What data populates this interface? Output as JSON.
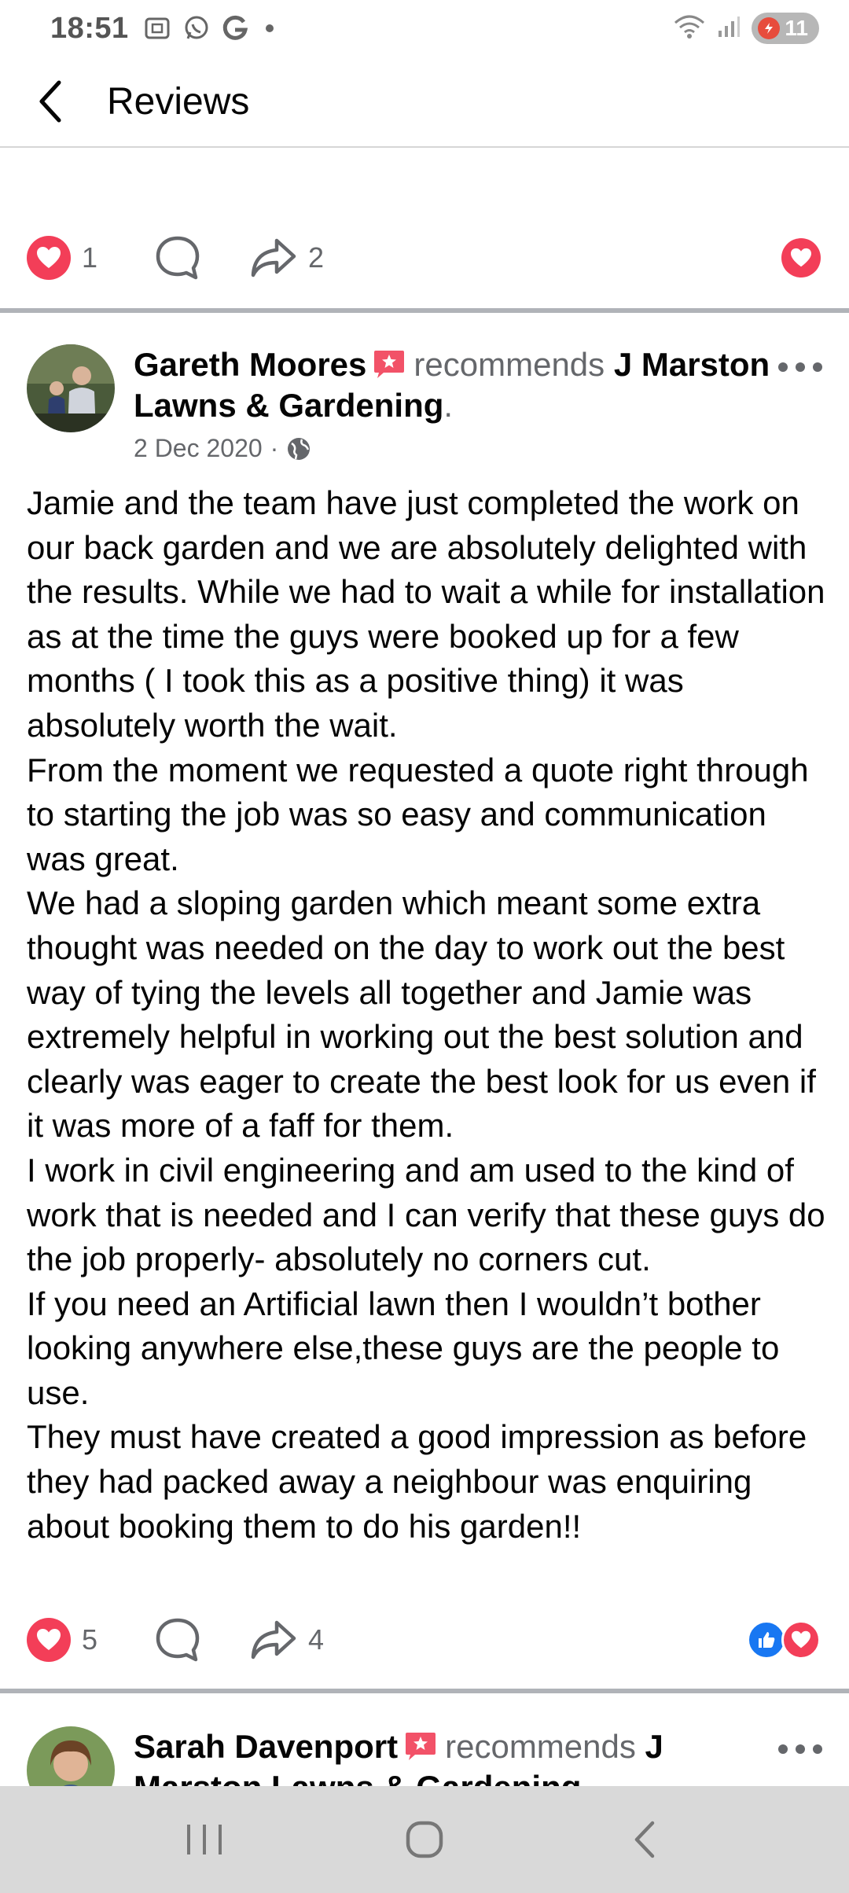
{
  "status_bar": {
    "time": "18:51",
    "battery_level": "11",
    "icons": [
      "screenshot-icon",
      "whatsapp-icon",
      "google-icon",
      "notification-dot",
      "wifi-icon",
      "signal-icon",
      "battery-icon"
    ]
  },
  "header": {
    "title": "Reviews",
    "back_icon": "chevron-left-icon"
  },
  "previous_post": {
    "reactions": {
      "love_count": "1",
      "share_count": "2"
    }
  },
  "post": {
    "author": "Gareth Moores",
    "recommends_text": "recommends",
    "page_name": "J Marston Lawns & Gardening",
    "date": "2 Dec 2020",
    "date_separator": "·",
    "privacy_icon": "globe-icon",
    "body": "Jamie and the team have just completed the work on our back garden and we are absolutely delighted with the results. While we had to wait a while for installation as at the time the guys were booked up for a few months ( I took this as a positive thing) it was absolutely worth the wait. \nFrom the moment we requested a quote right through to starting the job was so easy and communication was great. \nWe had a sloping garden which meant some extra thought was needed on the day to work out the best way of tying the levels all together and Jamie was extremely helpful in working out the best solution and clearly was eager to create the best look for us even if it was more of a faff for them. \nI work in civil engineering and am used to the kind of work that is needed and I can verify that these guys do the job properly- absolutely no corners cut. \nIf you need an Artificial lawn then I wouldn’t bother looking anywhere else,these guys are the people to use. \nThey must have created a good impression as before they had packed away a neighbour was enquiring about booking them to do his garden!!",
    "reactions": {
      "love_count": "5",
      "share_count": "4"
    }
  },
  "next_post": {
    "author": "Sarah Davenport",
    "recommends_text": "recommends",
    "page_name": "J Marston Lawns & Gardening"
  },
  "nav_bar": {
    "buttons": [
      "recent-apps-icon",
      "home-icon",
      "back-icon"
    ]
  },
  "colors": {
    "love": "#f33e58",
    "like": "#1877f2",
    "secondary_text": "#65676b",
    "separator": "#b0b3b8",
    "nav_bg": "#d9d9d9"
  }
}
